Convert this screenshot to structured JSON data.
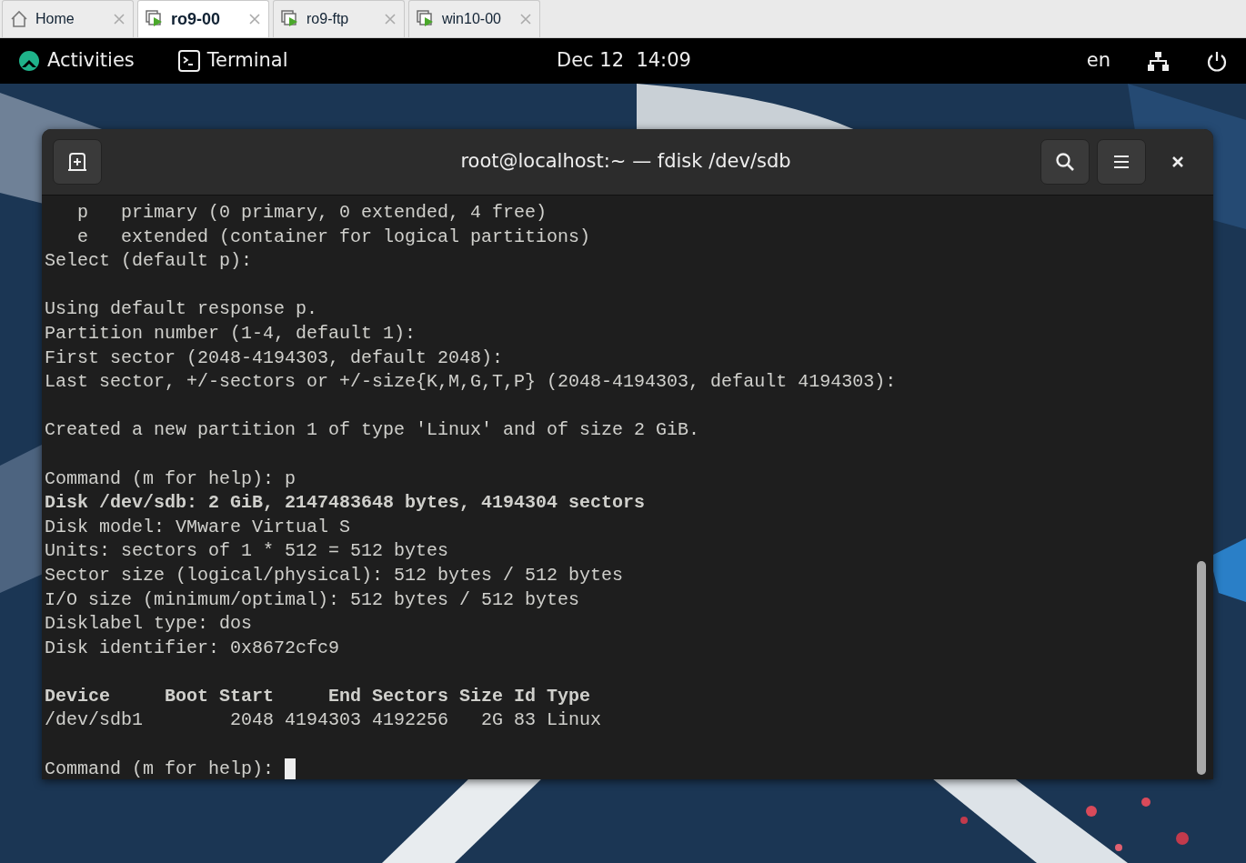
{
  "browser_tabs": [
    {
      "label": "Home",
      "kind": "home",
      "selected": false
    },
    {
      "label": "ro9-00",
      "kind": "vm",
      "selected": true
    },
    {
      "label": "ro9-ftp",
      "kind": "vm",
      "selected": false
    },
    {
      "label": "win10-00",
      "kind": "vm",
      "selected": false
    }
  ],
  "top_bar": {
    "activities": "Activities",
    "app": "Terminal",
    "clock": "Dec 12  14:09",
    "language": "en"
  },
  "window": {
    "title": "root@localhost:~ — fdisk /dev/sdb"
  },
  "terminal": {
    "blocks": [
      [
        {
          "text": "   p   primary (0 primary, 0 extended, 4 free)",
          "bold": false
        },
        {
          "text": "   e   extended (container for logical partitions)",
          "bold": false
        },
        {
          "text": "Select (default p):",
          "bold": false
        }
      ],
      [
        {
          "text": "Using default response p.",
          "bold": false
        },
        {
          "text": "Partition number (1-4, default 1):",
          "bold": false
        },
        {
          "text": "First sector (2048-4194303, default 2048):",
          "bold": false
        },
        {
          "text": "Last sector, +/-sectors or +/-size{K,M,G,T,P} (2048-4194303, default 4194303):",
          "bold": false
        }
      ],
      [
        {
          "text": "Created a new partition 1 of type 'Linux' and of size 2 GiB.",
          "bold": false
        }
      ],
      [
        {
          "text": "Command (m for help): p",
          "bold": false
        },
        {
          "text": "Disk /dev/sdb: 2 GiB, 2147483648 bytes, 4194304 sectors",
          "bold": true
        },
        {
          "text": "Disk model: VMware Virtual S",
          "bold": false
        },
        {
          "text": "Units: sectors of 1 * 512 = 512 bytes",
          "bold": false
        },
        {
          "text": "Sector size (logical/physical): 512 bytes / 512 bytes",
          "bold": false
        },
        {
          "text": "I/O size (minimum/optimal): 512 bytes / 512 bytes",
          "bold": false
        },
        {
          "text": "Disklabel type: dos",
          "bold": false
        },
        {
          "text": "Disk identifier: 0x8672cfc9",
          "bold": false
        }
      ],
      [
        {
          "text": "Device     Boot Start     End Sectors Size Id Type",
          "bold": true
        },
        {
          "text": "/dev/sdb1        2048 4194303 4192256   2G 83 Linux",
          "bold": false
        }
      ]
    ],
    "prompt": "Command (m for help): "
  }
}
